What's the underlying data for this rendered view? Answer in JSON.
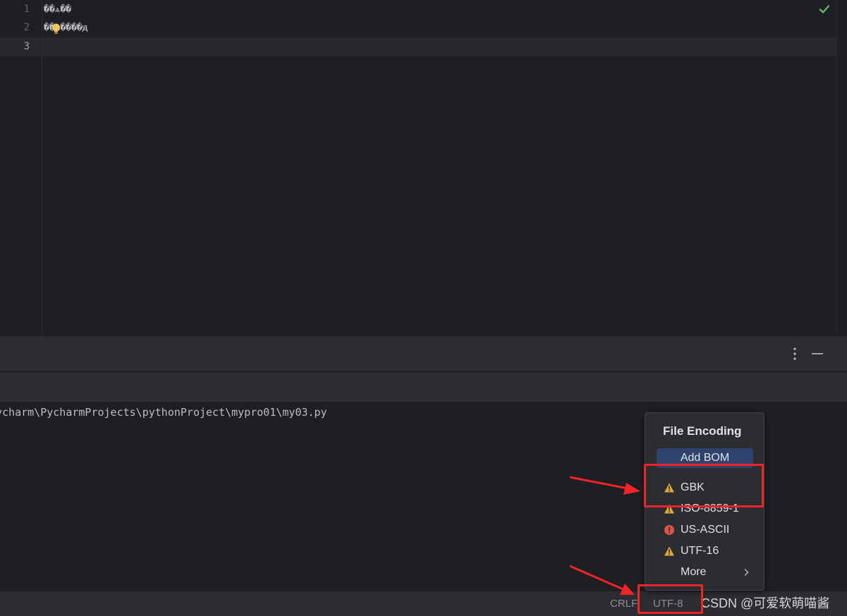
{
  "editor": {
    "lines": [
      {
        "number": "1",
        "text": "��ѧ��"
      },
      {
        "number": "2",
        "text": "��ѧ����ԭ"
      },
      {
        "number": "3",
        "text": ""
      }
    ]
  },
  "console": {
    "output": "ycharm\\PycharmProjects\\pythonProject\\mypro01\\my03.py"
  },
  "popup": {
    "title": "File Encoding",
    "add_bom_label": "Add BOM",
    "items": [
      {
        "label": "GBK",
        "icon": "warning-icon"
      },
      {
        "label": "ISO-8859-1",
        "icon": "warning-icon"
      },
      {
        "label": "US-ASCII",
        "icon": "error-icon"
      },
      {
        "label": "UTF-16",
        "icon": "warning-icon"
      },
      {
        "label": "More",
        "icon": ""
      }
    ]
  },
  "status_bar": {
    "line_separator": "CRLF",
    "encoding": "UTF-8",
    "watermark": "CSDN @可爱软萌喵酱"
  },
  "colors": {
    "accent_blue": "#2e436e",
    "warning": "#e0a63b",
    "error": "#d9534f",
    "annotation_red": "#f2242a",
    "check_green": "#5fb865"
  }
}
